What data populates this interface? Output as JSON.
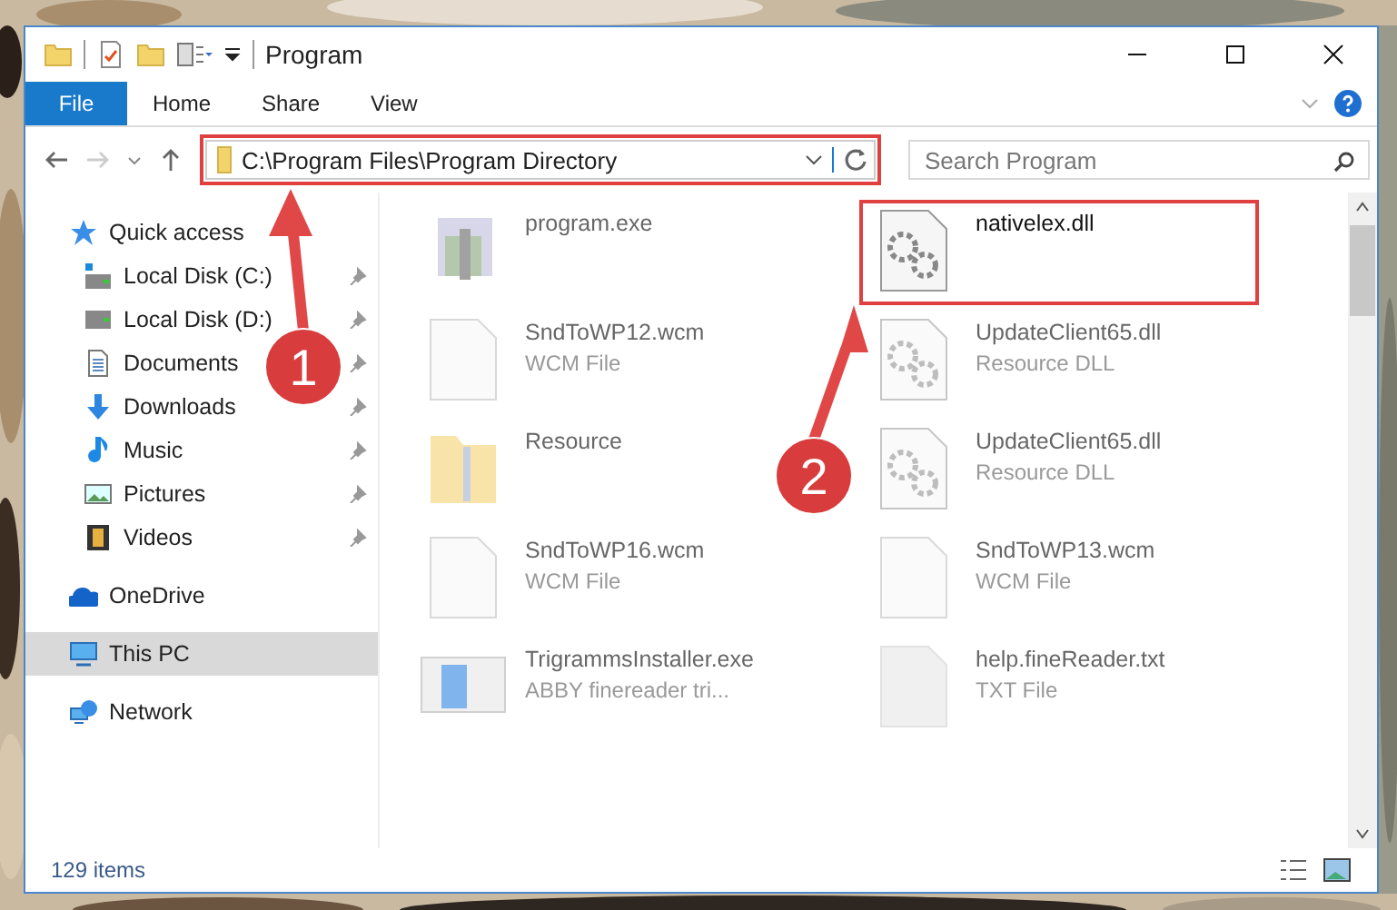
{
  "window": {
    "title": "Program"
  },
  "file_tab": "File",
  "ribbon_tabs": [
    "Home",
    "Share",
    "View"
  ],
  "address": {
    "path": "C:\\Program Files\\Program Directory",
    "marked": true
  },
  "search": {
    "placeholder": "Search Program"
  },
  "nav": [
    {
      "label": "Quick access",
      "kind": "star",
      "selected": false,
      "children": [
        {
          "label": "Local Disk (C:)",
          "kind": "disk-c",
          "pinned": true,
          "selected": false
        },
        {
          "label": "Local Disk (D:)",
          "kind": "disk",
          "pinned": true,
          "selected": false
        },
        {
          "label": "Documents",
          "kind": "doc",
          "pinned": true,
          "selected": false
        },
        {
          "label": "Downloads",
          "kind": "download",
          "pinned": true,
          "selected": false
        },
        {
          "label": "Music",
          "kind": "music",
          "pinned": true,
          "selected": false
        },
        {
          "label": "Pictures",
          "kind": "pictures",
          "pinned": true,
          "selected": false
        },
        {
          "label": "Videos",
          "kind": "videos",
          "pinned": true,
          "selected": false
        }
      ]
    },
    {
      "label": "OneDrive",
      "kind": "cloud",
      "selected": false
    },
    {
      "label": "This PC",
      "kind": "pc",
      "selected": true
    },
    {
      "label": "Network",
      "kind": "network",
      "selected": false
    }
  ],
  "files": [
    {
      "name": "program.exe",
      "kind": "exe",
      "blurred": true,
      "marked": false
    },
    {
      "name": "nativelex.dll",
      "kind": "dll",
      "blurred": false,
      "marked": true
    },
    {
      "name": "SndToWP12.wcm",
      "type": "WCM File",
      "kind": "blank",
      "blurred": true,
      "marked": false
    },
    {
      "name": "UpdateClient65.dll",
      "type": "Resource DLL",
      "kind": "dll",
      "blurred": true,
      "marked": false
    },
    {
      "name": "Resource",
      "kind": "folder",
      "blurred": true,
      "marked": false
    },
    {
      "name": "UpdateClient65.dll",
      "type": "Resource DLL",
      "kind": "dll",
      "blurred": true,
      "marked": false
    },
    {
      "name": "SndToWP16.wcm",
      "type": "WCM File",
      "kind": "blank",
      "blurred": true,
      "marked": false
    },
    {
      "name": "SndToWP13.wcm",
      "type": "WCM File",
      "kind": "blank",
      "blurred": true,
      "marked": false
    },
    {
      "name": "TrigrammsInstaller.exe",
      "type": "ABBY finereader tri...",
      "kind": "installer",
      "blurred": true,
      "marked": false
    },
    {
      "name": "help.fineReader.txt",
      "type": "TXT File",
      "kind": "txt",
      "blurred": true,
      "marked": false
    }
  ],
  "status_bar": "129 items",
  "callouts": [
    "1",
    "2"
  ]
}
